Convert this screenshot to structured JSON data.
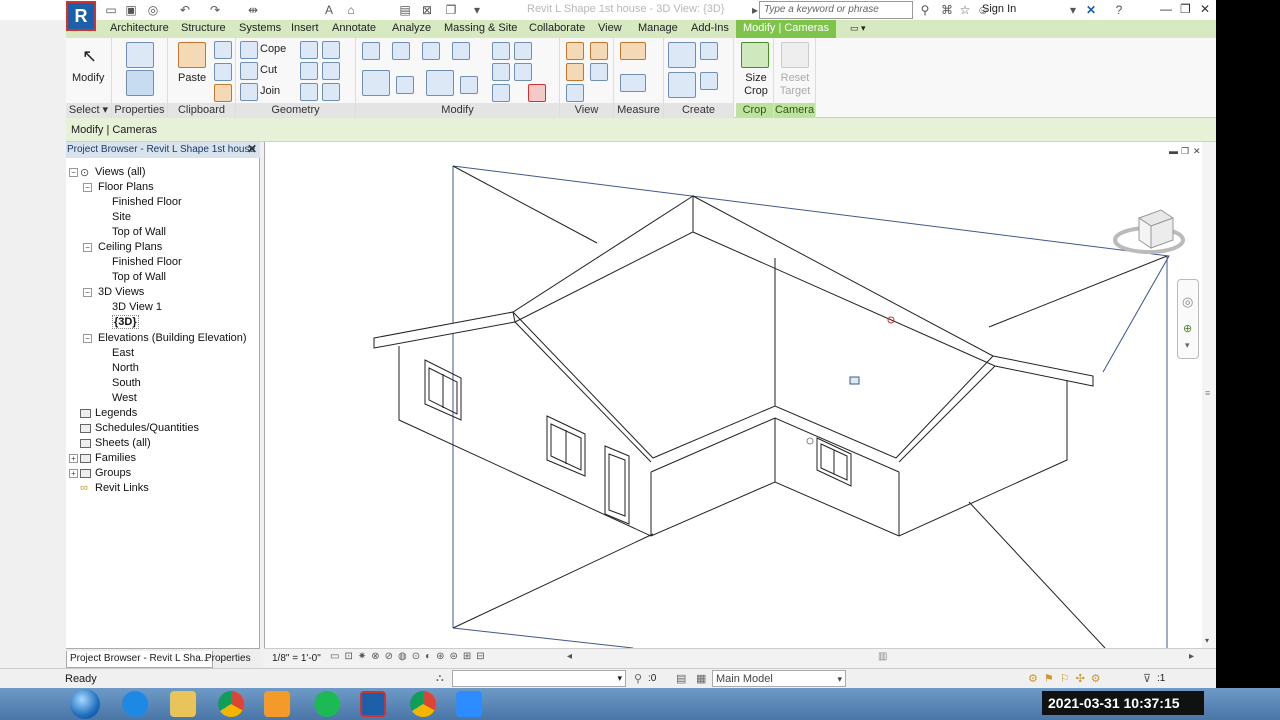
{
  "window": {
    "title": "Revit L Shape 1st house - 3D View: {3D}",
    "search_placeholder": "Type a keyword or phrase",
    "sign_in": "Sign In",
    "logo": "R"
  },
  "ribbon_tabs": [
    "Architecture",
    "Structure",
    "Systems",
    "Insert",
    "Annotate",
    "Analyze",
    "Massing & Site",
    "Collaborate",
    "View",
    "Manage",
    "Add-Ins"
  ],
  "active_tab": "Modify | Cameras",
  "panels": {
    "select": {
      "label": "Select",
      "modify_label": "Modify"
    },
    "properties": {
      "label": "Properties"
    },
    "clipboard": {
      "label": "Clipboard",
      "paste_label": "Paste"
    },
    "geometry": {
      "label": "Geometry",
      "cope": "Cope",
      "cut": "Cut",
      "join": "Join"
    },
    "modify": {
      "label": "Modify"
    },
    "view": {
      "label": "View"
    },
    "measure": {
      "label": "Measure"
    },
    "create": {
      "label": "Create"
    },
    "crop": {
      "label": "Crop",
      "size_crop": "Size Crop"
    },
    "camera": {
      "label": "Camera",
      "reset_target": "Reset Target"
    }
  },
  "context_label": "Modify | Cameras",
  "project_browser": {
    "title": "Project Browser - Revit L Shape 1st house",
    "tree": {
      "views_all": "Views (all)",
      "floor_plans": "Floor Plans",
      "fp_finished_floor": "Finished Floor",
      "fp_site": "Site",
      "fp_top_of_wall": "Top of Wall",
      "ceiling_plans": "Ceiling Plans",
      "cp_finished_floor": "Finished Floor",
      "cp_top_of_wall": "Top of Wall",
      "views_3d": "3D Views",
      "view_3d_1": "3D View 1",
      "view_3d_default": "{3D}",
      "elevations": "Elevations (Building Elevation)",
      "elev_east": "East",
      "elev_north": "North",
      "elev_south": "South",
      "elev_west": "West",
      "legends": "Legends",
      "schedules": "Schedules/Quantities",
      "sheets": "Sheets (all)",
      "families": "Families",
      "groups": "Groups",
      "revit_links": "Revit Links"
    },
    "tabs": [
      "Project Browser - Revit L Sha...",
      "Properties"
    ]
  },
  "view_control": {
    "scale": "1/8\" = 1'-0\""
  },
  "status": {
    "text": "Ready",
    "selection_count": ":0",
    "model": "Main Model",
    "filter_count": ":1"
  },
  "taskbar": {
    "clock": "2021-03-31 10:37:15"
  }
}
